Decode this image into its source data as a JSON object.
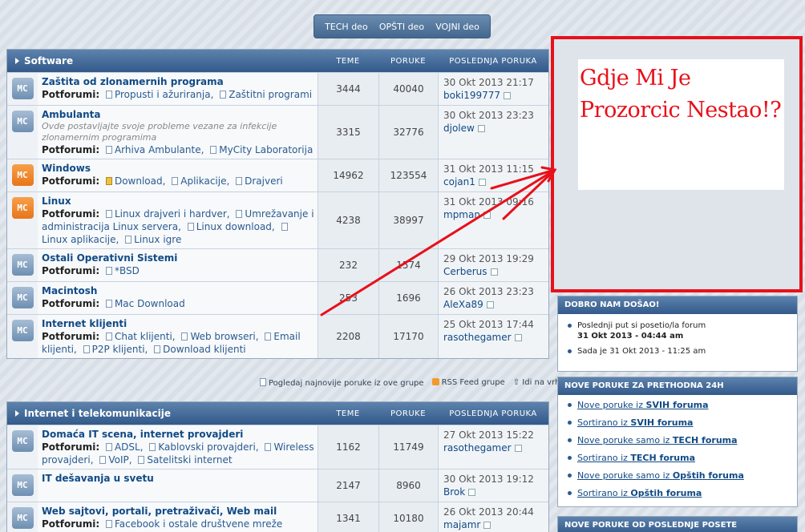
{
  "topnav": [
    "TECH deo",
    "OPŠTI deo",
    "VOJNI deo"
  ],
  "columns": {
    "topics": "TEME",
    "posts": "PORUKE",
    "last": "POSLEDNJA PORUKA"
  },
  "subforums_label": "Potforumi:",
  "groups": [
    {
      "name": "Software",
      "forums": [
        {
          "icon": "blue",
          "name": "Zaštita od zlonamernih programa",
          "desc": "",
          "subs": [
            "Propusti i ažuriranja",
            "Zaštitni programi"
          ],
          "topics": "3444",
          "posts": "40040",
          "date": "30 Okt 2013 21:17",
          "user": "boki199777"
        },
        {
          "icon": "blue",
          "name": "Ambulanta",
          "desc": "Ovde postavljajte svoje probleme vezane za infekcije zlonamernim programima",
          "subs": [
            "Arhiva Ambulante",
            "MyCity Laboratorija"
          ],
          "topics": "3315",
          "posts": "32776",
          "date": "30 Okt 2013 23:23",
          "user": "djolew"
        },
        {
          "icon": "orange",
          "name": "Windows",
          "desc": "",
          "subs": [
            "Download",
            "Aplikacije",
            "Drajveri"
          ],
          "topics": "14962",
          "posts": "123554",
          "date": "31 Okt 2013 11:15",
          "user": "cojan1"
        },
        {
          "icon": "orange",
          "name": "Linux",
          "desc": "",
          "subs": [
            "Linux drajveri i hardver",
            "Umrežavanje i administracija Linux servera",
            "Linux download",
            "Linux aplikacije",
            "Linux igre"
          ],
          "topics": "4238",
          "posts": "38997",
          "date": "31 Okt 2013 09:16",
          "user": "mpman"
        },
        {
          "icon": "blue",
          "name": "Ostali Operativni Sistemi",
          "desc": "",
          "subs": [
            "*BSD"
          ],
          "topics": "232",
          "posts": "1574",
          "date": "29 Okt 2013 19:29",
          "user": "Cerberus"
        },
        {
          "icon": "blue",
          "name": "Macintosh",
          "desc": "",
          "subs": [
            "Mac Download"
          ],
          "topics": "253",
          "posts": "1696",
          "date": "26 Okt 2013 23:23",
          "user": "AleXa89"
        },
        {
          "icon": "blue",
          "name": "Internet klijenti",
          "desc": "",
          "subs": [
            "Chat klijenti",
            "Web browseri",
            "Email klijenti",
            "P2P klijenti",
            "Download klijenti"
          ],
          "topics": "2208",
          "posts": "17170",
          "date": "25 Okt 2013 17:44",
          "user": "rasothegamer"
        }
      ]
    },
    {
      "name": "Internet i telekomunikacije",
      "forums": [
        {
          "icon": "blue",
          "name": "Domaća IT scena, internet provajderi",
          "desc": "",
          "subs": [
            "ADSL",
            "Kablovski provajderi",
            "Wireless provajderi",
            "VoIP",
            "Satelitski internet"
          ],
          "topics": "1162",
          "posts": "11749",
          "date": "27 Okt 2013 15:22",
          "user": "rasothegamer"
        },
        {
          "icon": "blue",
          "name": "IT dešavanja u svetu",
          "desc": "",
          "subs": [],
          "topics": "2147",
          "posts": "8960",
          "date": "30 Okt 2013 19:12",
          "user": "Brok"
        },
        {
          "icon": "blue",
          "name": "Web sajtovi, portali, pretraživači, Web mail",
          "desc": "",
          "subs": [
            "Facebook i ostale društvene mreže"
          ],
          "topics": "1341",
          "posts": "10180",
          "date": "26 Okt 2013 20:44",
          "user": "majamr"
        }
      ]
    }
  ],
  "group_footer": {
    "latest": "Pogledaj najnovije poruke iz ove grupe",
    "rss": "RSS Feed grupe",
    "top": "Idi na vrh"
  },
  "annotation": {
    "line1": "Gdje Mi Je",
    "line2": "Prozorcic Nestao!?",
    "color": "#e8101a"
  },
  "welcome": {
    "title": "DOBRO NAM DOŠAO!",
    "last_visit_label": "Poslednji put si posetio/la forum",
    "last_visit_value": "31 Okt 2013 - 04:44 am",
    "now_label": "Sada je",
    "now_value": "31 Okt 2013 - 11:25 am"
  },
  "new24": {
    "title": "NOVE PORUKE ZA PRETHODNA 24H",
    "links": [
      {
        "pre": "Nove poruke iz ",
        "bold": "SVIH foruma"
      },
      {
        "pre": "Sortirano iz ",
        "bold": "SVIH foruma"
      },
      {
        "pre": "Nove poruke samo iz ",
        "bold": "TECH foruma"
      },
      {
        "pre": "Sortirano iz ",
        "bold": "TECH foruma"
      },
      {
        "pre": "Nove poruke samo iz ",
        "bold": "Opštih foruma"
      },
      {
        "pre": "Sortirano iz ",
        "bold": "Opštih foruma"
      }
    ]
  },
  "lastvisit_panel": {
    "title": "NOVE PORUKE OD POSLEDNJE POSETE"
  }
}
